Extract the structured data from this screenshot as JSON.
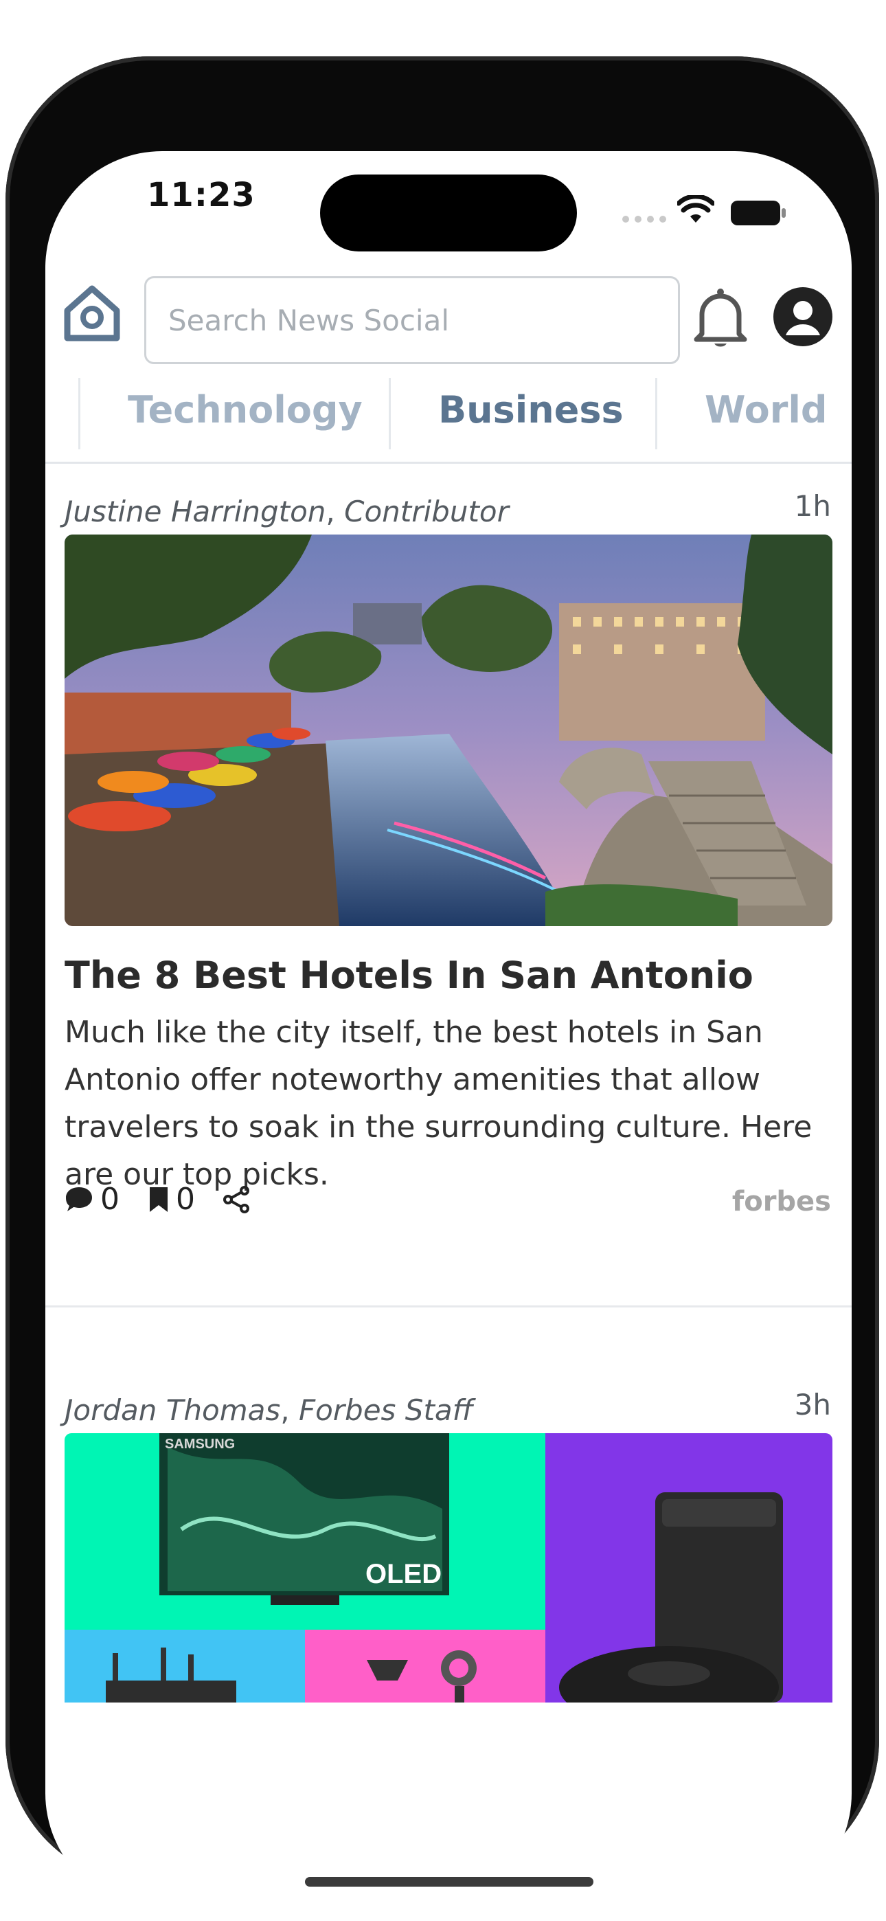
{
  "status_bar": {
    "time": "11:23"
  },
  "header": {
    "search_placeholder": "Search News Social"
  },
  "tabs": [
    {
      "label": "Technology",
      "active": false
    },
    {
      "label": "Business",
      "active": true
    },
    {
      "label": "World",
      "active": false
    }
  ],
  "articles": [
    {
      "author": "Justine Harrington",
      "role": "Contributor",
      "time": "1h",
      "title": "The 8 Best Hotels In San Antonio",
      "description": "Much like the city itself, the best hotels in San Antonio offer noteworthy amenities that allow travelers to soak in the surrounding culture. Here are our top picks.",
      "comments": "0",
      "bookmarks": "0",
      "source": "forbes"
    },
    {
      "author": "Jordan Thomas",
      "role": "Forbes Staff",
      "time": "3h",
      "image_brand_text": "SAMSUNG",
      "image_product_text": "OLED"
    }
  ],
  "colors": {
    "tab_active": "#5b7590",
    "tab_inactive": "#a3b3c4",
    "icon_blue": "#5b7590"
  }
}
